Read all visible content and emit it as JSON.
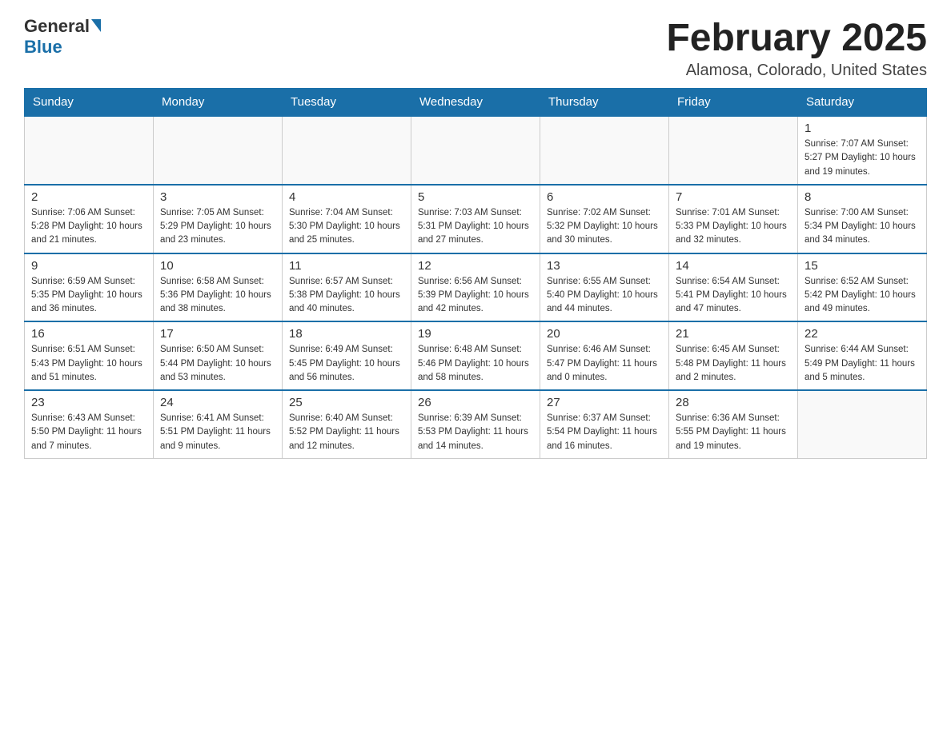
{
  "header": {
    "logo_general": "General",
    "logo_blue": "Blue",
    "month_title": "February 2025",
    "location": "Alamosa, Colorado, United States"
  },
  "days_of_week": [
    "Sunday",
    "Monday",
    "Tuesday",
    "Wednesday",
    "Thursday",
    "Friday",
    "Saturday"
  ],
  "weeks": [
    [
      {
        "day": "",
        "info": ""
      },
      {
        "day": "",
        "info": ""
      },
      {
        "day": "",
        "info": ""
      },
      {
        "day": "",
        "info": ""
      },
      {
        "day": "",
        "info": ""
      },
      {
        "day": "",
        "info": ""
      },
      {
        "day": "1",
        "info": "Sunrise: 7:07 AM\nSunset: 5:27 PM\nDaylight: 10 hours and 19 minutes."
      }
    ],
    [
      {
        "day": "2",
        "info": "Sunrise: 7:06 AM\nSunset: 5:28 PM\nDaylight: 10 hours and 21 minutes."
      },
      {
        "day": "3",
        "info": "Sunrise: 7:05 AM\nSunset: 5:29 PM\nDaylight: 10 hours and 23 minutes."
      },
      {
        "day": "4",
        "info": "Sunrise: 7:04 AM\nSunset: 5:30 PM\nDaylight: 10 hours and 25 minutes."
      },
      {
        "day": "5",
        "info": "Sunrise: 7:03 AM\nSunset: 5:31 PM\nDaylight: 10 hours and 27 minutes."
      },
      {
        "day": "6",
        "info": "Sunrise: 7:02 AM\nSunset: 5:32 PM\nDaylight: 10 hours and 30 minutes."
      },
      {
        "day": "7",
        "info": "Sunrise: 7:01 AM\nSunset: 5:33 PM\nDaylight: 10 hours and 32 minutes."
      },
      {
        "day": "8",
        "info": "Sunrise: 7:00 AM\nSunset: 5:34 PM\nDaylight: 10 hours and 34 minutes."
      }
    ],
    [
      {
        "day": "9",
        "info": "Sunrise: 6:59 AM\nSunset: 5:35 PM\nDaylight: 10 hours and 36 minutes."
      },
      {
        "day": "10",
        "info": "Sunrise: 6:58 AM\nSunset: 5:36 PM\nDaylight: 10 hours and 38 minutes."
      },
      {
        "day": "11",
        "info": "Sunrise: 6:57 AM\nSunset: 5:38 PM\nDaylight: 10 hours and 40 minutes."
      },
      {
        "day": "12",
        "info": "Sunrise: 6:56 AM\nSunset: 5:39 PM\nDaylight: 10 hours and 42 minutes."
      },
      {
        "day": "13",
        "info": "Sunrise: 6:55 AM\nSunset: 5:40 PM\nDaylight: 10 hours and 44 minutes."
      },
      {
        "day": "14",
        "info": "Sunrise: 6:54 AM\nSunset: 5:41 PM\nDaylight: 10 hours and 47 minutes."
      },
      {
        "day": "15",
        "info": "Sunrise: 6:52 AM\nSunset: 5:42 PM\nDaylight: 10 hours and 49 minutes."
      }
    ],
    [
      {
        "day": "16",
        "info": "Sunrise: 6:51 AM\nSunset: 5:43 PM\nDaylight: 10 hours and 51 minutes."
      },
      {
        "day": "17",
        "info": "Sunrise: 6:50 AM\nSunset: 5:44 PM\nDaylight: 10 hours and 53 minutes."
      },
      {
        "day": "18",
        "info": "Sunrise: 6:49 AM\nSunset: 5:45 PM\nDaylight: 10 hours and 56 minutes."
      },
      {
        "day": "19",
        "info": "Sunrise: 6:48 AM\nSunset: 5:46 PM\nDaylight: 10 hours and 58 minutes."
      },
      {
        "day": "20",
        "info": "Sunrise: 6:46 AM\nSunset: 5:47 PM\nDaylight: 11 hours and 0 minutes."
      },
      {
        "day": "21",
        "info": "Sunrise: 6:45 AM\nSunset: 5:48 PM\nDaylight: 11 hours and 2 minutes."
      },
      {
        "day": "22",
        "info": "Sunrise: 6:44 AM\nSunset: 5:49 PM\nDaylight: 11 hours and 5 minutes."
      }
    ],
    [
      {
        "day": "23",
        "info": "Sunrise: 6:43 AM\nSunset: 5:50 PM\nDaylight: 11 hours and 7 minutes."
      },
      {
        "day": "24",
        "info": "Sunrise: 6:41 AM\nSunset: 5:51 PM\nDaylight: 11 hours and 9 minutes."
      },
      {
        "day": "25",
        "info": "Sunrise: 6:40 AM\nSunset: 5:52 PM\nDaylight: 11 hours and 12 minutes."
      },
      {
        "day": "26",
        "info": "Sunrise: 6:39 AM\nSunset: 5:53 PM\nDaylight: 11 hours and 14 minutes."
      },
      {
        "day": "27",
        "info": "Sunrise: 6:37 AM\nSunset: 5:54 PM\nDaylight: 11 hours and 16 minutes."
      },
      {
        "day": "28",
        "info": "Sunrise: 6:36 AM\nSunset: 5:55 PM\nDaylight: 11 hours and 19 minutes."
      },
      {
        "day": "",
        "info": ""
      }
    ]
  ]
}
